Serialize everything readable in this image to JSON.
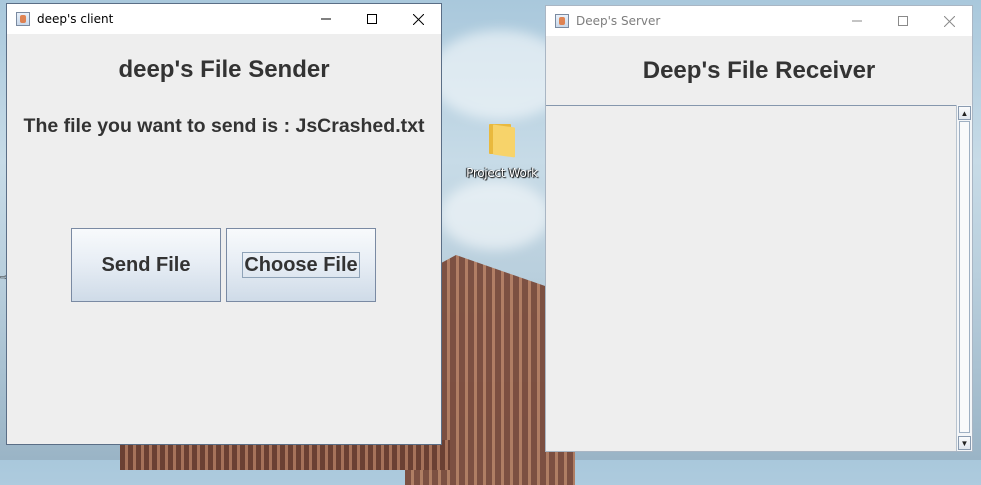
{
  "desktop": {
    "icons": [
      {
        "label": "Project Work",
        "icon": "folder-icon"
      }
    ]
  },
  "client_window": {
    "title": "deep's client",
    "heading": "deep's File Sender",
    "message": "The file you want to send is : JsCrashed.txt",
    "buttons": {
      "send": "Send File",
      "choose": "Choose File"
    },
    "controls": [
      "minimize-icon",
      "maximize-icon",
      "close-icon"
    ]
  },
  "server_window": {
    "title": "Deep's Server",
    "heading": "Deep's File Receiver",
    "log_text": "",
    "controls": [
      "minimize-icon",
      "maximize-icon",
      "close-icon"
    ]
  }
}
